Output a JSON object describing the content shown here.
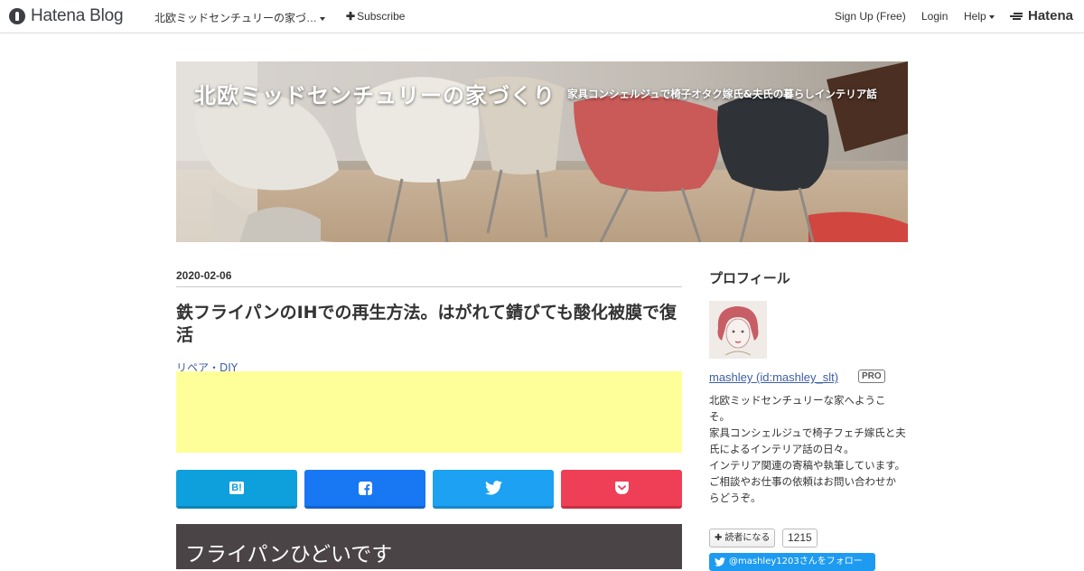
{
  "topbar": {
    "brand": "Hatena Blog",
    "blog_selector": "北欧ミッドセンチュリーの家づ…",
    "subscribe": "Subscribe",
    "signup": "Sign Up (Free)",
    "login": "Login",
    "help": "Help",
    "hatena": "Hatena"
  },
  "header": {
    "title": "北欧ミッドセンチュリーの家づくり",
    "description": "家具コンシェルジュで椅子オタク嫁氏&夫氏の暮らしインテリア話"
  },
  "entry": {
    "date": "2020-02-06",
    "title": "鉄フライパンのIHでの再生方法。はがれて錆びても酸化被膜で復活",
    "category": "リペア・DIY",
    "section_heading": "フライパンひどいです"
  },
  "share": {
    "hatebu_label": "B!"
  },
  "sidebar": {
    "profile_heading": "プロフィール",
    "profile_name": "mashley (id:mashley_slt)",
    "pro_badge": "PRO",
    "bio_lines": [
      "北欧ミッドセンチュリーな家へようこそ。",
      "家具コンシェルジュで椅子フェチ嫁氏と夫氏によるインテリア話の日々。",
      "インテリア関連の寄稿や執筆しています。",
      "ご相談やお仕事の依頼はお問い合わせからどうぞ。"
    ],
    "reader_button": "読者になる",
    "reader_count": "1215",
    "twitter_follow": "@mashley1203さんをフォロー"
  },
  "colors": {
    "ad_background": "#ffff99",
    "hatebu": "#0ea0dc",
    "facebook": "#1877f2",
    "twitter": "#1da1f2",
    "pocket": "#ef3f56",
    "heading_background": "#4a4446",
    "link": "#3e5ea5"
  }
}
